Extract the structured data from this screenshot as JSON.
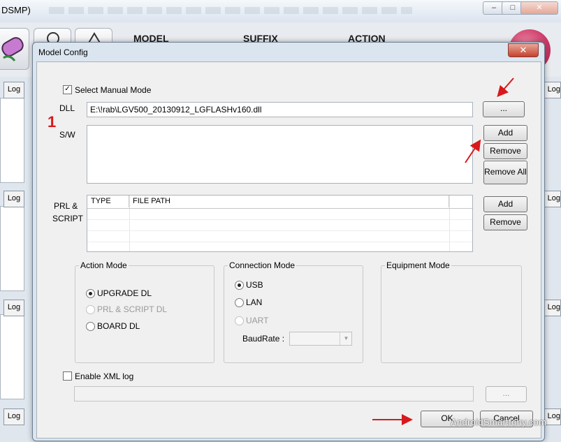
{
  "background_app": {
    "title_fragment": "DSMP)",
    "window_controls": [
      "–",
      "□",
      "✕"
    ],
    "columns": [
      "MODEL",
      "SUFFIX",
      "ACTION"
    ],
    "log_label": "Log"
  },
  "dialog": {
    "title": "Model Config",
    "close_label": "✕",
    "annotation_number": "1",
    "select_manual_mode": {
      "label": "Select Manual Mode",
      "checked": true
    },
    "dll": {
      "label": "DLL",
      "value": "E:\\!rab\\LGV500_20130912_LGFLASHv160.dll",
      "browse_label": "..."
    },
    "sw": {
      "label": "S/W",
      "buttons": {
        "add": "Add",
        "remove": "Remove",
        "remove_all": "Remove All"
      }
    },
    "prl_script": {
      "label_line1": "PRL  &",
      "label_line2": "SCRIPT",
      "columns": [
        "TYPE",
        "FILE PATH"
      ],
      "buttons": {
        "add": "Add",
        "remove": "Remove"
      }
    },
    "action_mode": {
      "title": "Action Mode",
      "options": [
        {
          "label": "UPGRADE DL",
          "selected": true,
          "enabled": true
        },
        {
          "label": "PRL & SCRIPT DL",
          "selected": false,
          "enabled": false
        },
        {
          "label": "BOARD DL",
          "selected": false,
          "enabled": true
        }
      ]
    },
    "connection_mode": {
      "title": "Connection Mode",
      "options": [
        {
          "label": "USB",
          "selected": true,
          "enabled": true
        },
        {
          "label": "LAN",
          "selected": false,
          "enabled": true
        },
        {
          "label": "UART",
          "selected": false,
          "enabled": false
        }
      ],
      "baudrate_label": "BaudRate :",
      "baudrate_value": ""
    },
    "equipment_mode": {
      "title": "Equipment Mode"
    },
    "enable_xml_log": {
      "label": "Enable XML log",
      "checked": false,
      "path_value": "",
      "browse_label": "..."
    },
    "ok_label": "OK",
    "cancel_label": "Cancel"
  },
  "watermark": "AndroidSmartfony.com",
  "colors": {
    "annotation_red": "#d8191b",
    "dialog_frame": "#dbe5ef",
    "client_bg": "#f0f0f0"
  }
}
